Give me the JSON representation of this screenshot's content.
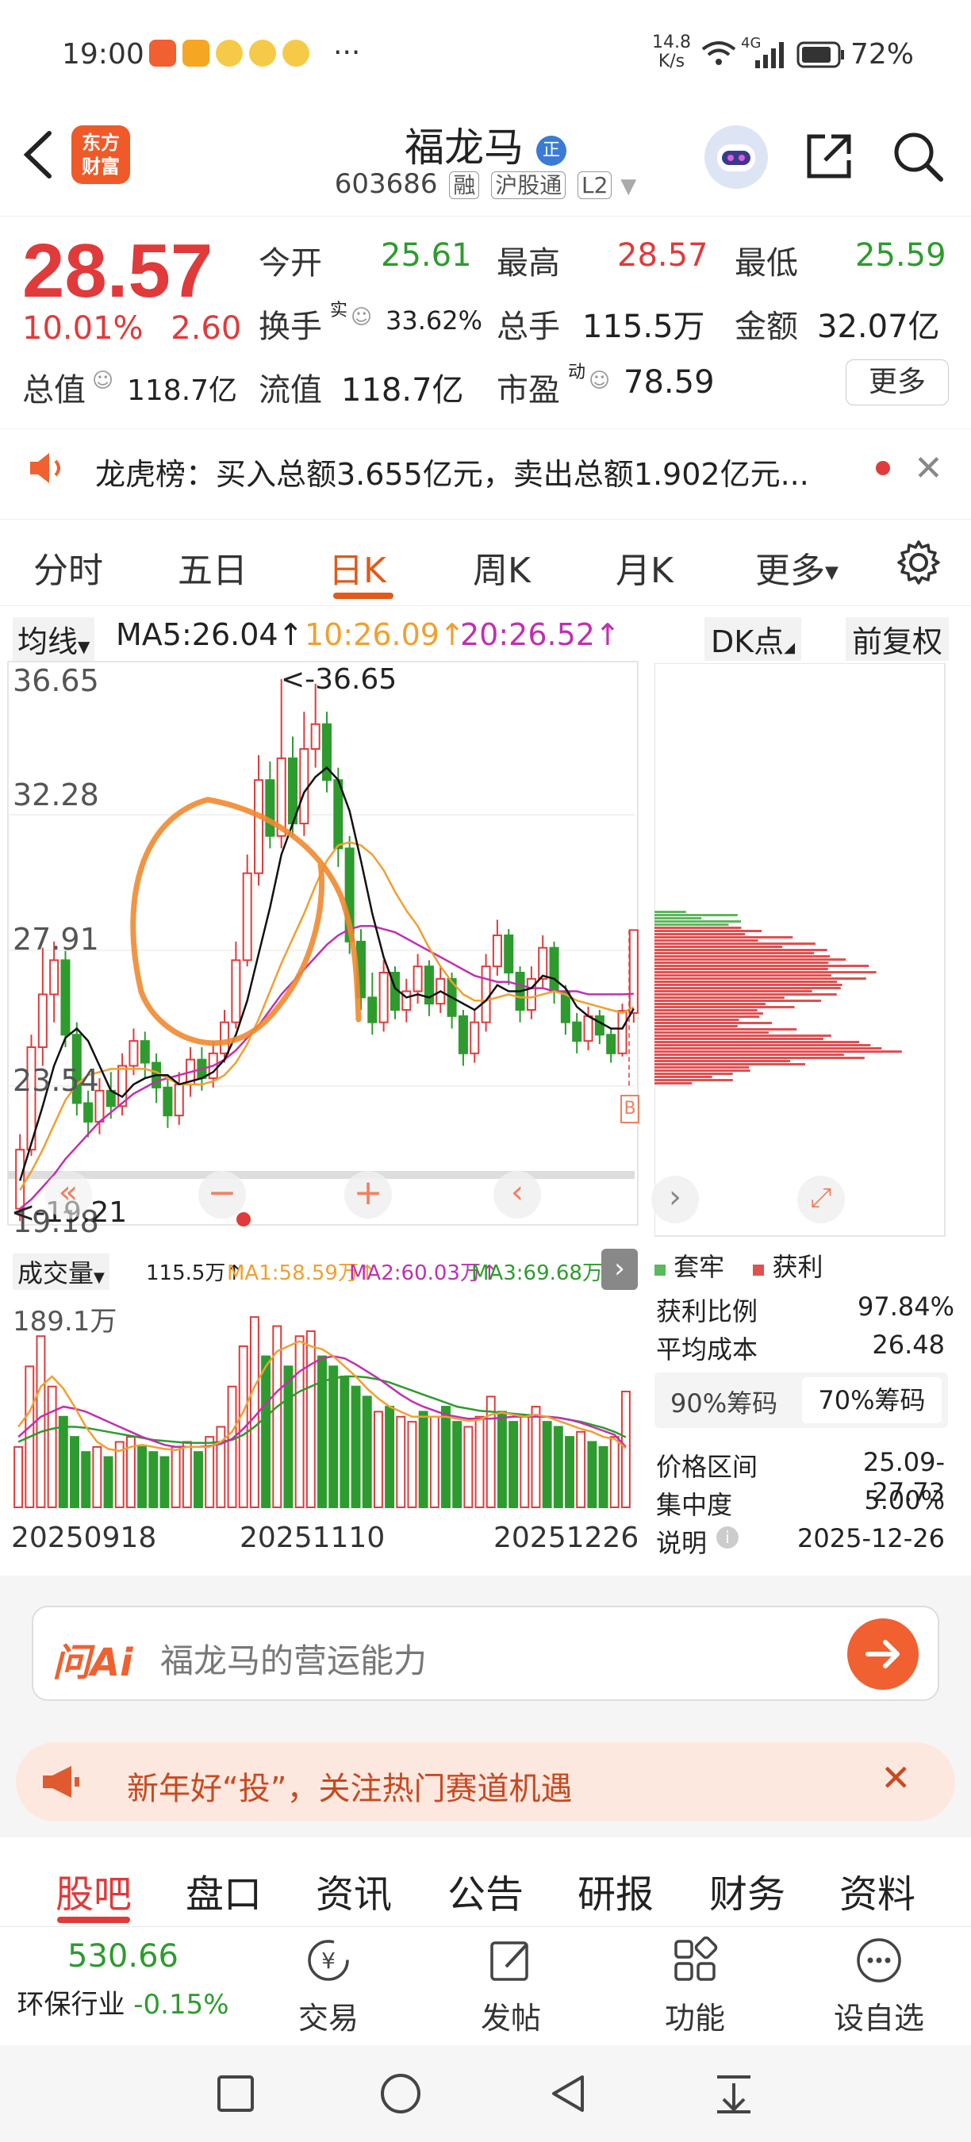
{
  "status_bar": {
    "time": "19:00",
    "extra": "···",
    "net_speed_top": "14.8",
    "net_speed_bottom": "K/s",
    "signal": "4G",
    "battery": "72%"
  },
  "header": {
    "back": "<",
    "logo_line1": "东方",
    "logo_line2": "财富",
    "stock_name": "福龙马",
    "name_badge": "正",
    "stock_code": "603686",
    "tags": [
      "融",
      "沪股通",
      "L2"
    ]
  },
  "quote": {
    "price": "28.57",
    "change_pct": "10.01%",
    "change_amt": "2.60",
    "open_label": "今开",
    "open": "25.61",
    "high_label": "最高",
    "high": "28.57",
    "low_label": "最低",
    "low": "25.59",
    "turnover_label": "换手",
    "turnover_sup": "实",
    "turnover": "33.62%",
    "volume_label": "总手",
    "volume": "115.5万",
    "amount_label": "金额",
    "amount": "32.07亿",
    "mktcap_label": "总值",
    "mktcap": "118.7亿",
    "float_label": "流值",
    "float_cap": "118.7亿",
    "pe_label": "市盈",
    "pe_sup": "动",
    "pe": "78.59",
    "more": "更多"
  },
  "notice": {
    "text": "龙虎榜：买入总额3.655亿元，卖出总额1.902亿元..."
  },
  "ktabs": [
    "分时",
    "五日",
    "日K",
    "周K",
    "月K",
    "更多"
  ],
  "ktab_active": 2,
  "chart_head": {
    "ma_select": "均线",
    "ma5": "MA5:26.04↑",
    "ma10": "10:26.09↑",
    "ma20": "20:26.52↑",
    "dk": "DK点",
    "adjust": "前复权"
  },
  "colors": {
    "up": "#e03a3a",
    "down": "#2e9b2e",
    "ma5": "#111111",
    "ma10": "#f0a030",
    "ma20": "#c030b0",
    "accent": "#e05a1a"
  },
  "chart_data": {
    "type": "candlestick",
    "y_ticks": [
      "36.65",
      "32.28",
      "27.91",
      "23.54",
      "19.18"
    ],
    "ylim": [
      19.18,
      36.65
    ],
    "annotations": [
      "<-36.65",
      "<-19.21"
    ],
    "x_labels": [
      "20250918",
      "20251110",
      "20251226"
    ],
    "candles": [
      {
        "o": 19.6,
        "c": 21.5,
        "h": 22.0,
        "l": 19.2
      },
      {
        "o": 21.5,
        "c": 24.8,
        "h": 25.2,
        "l": 21.3
      },
      {
        "o": 24.8,
        "c": 26.5,
        "h": 28.0,
        "l": 24.2
      },
      {
        "o": 26.5,
        "c": 27.6,
        "h": 28.2,
        "l": 25.6
      },
      {
        "o": 27.6,
        "c": 25.2,
        "h": 27.9,
        "l": 24.8
      },
      {
        "o": 25.2,
        "c": 23.0,
        "h": 25.6,
        "l": 22.6
      },
      {
        "o": 23.0,
        "c": 22.4,
        "h": 23.4,
        "l": 21.9
      },
      {
        "o": 22.4,
        "c": 23.4,
        "h": 23.8,
        "l": 22.0
      },
      {
        "o": 23.4,
        "c": 22.9,
        "h": 24.0,
        "l": 22.5
      },
      {
        "o": 22.9,
        "c": 24.2,
        "h": 24.6,
        "l": 22.6
      },
      {
        "o": 24.2,
        "c": 25.0,
        "h": 25.4,
        "l": 23.9
      },
      {
        "o": 25.0,
        "c": 24.3,
        "h": 25.3,
        "l": 23.8
      },
      {
        "o": 24.3,
        "c": 23.5,
        "h": 24.6,
        "l": 23.0
      },
      {
        "o": 23.5,
        "c": 22.6,
        "h": 23.9,
        "l": 22.2
      },
      {
        "o": 22.6,
        "c": 23.6,
        "h": 24.0,
        "l": 22.3
      },
      {
        "o": 23.6,
        "c": 24.4,
        "h": 24.8,
        "l": 23.2
      },
      {
        "o": 24.4,
        "c": 23.8,
        "h": 24.8,
        "l": 23.4
      },
      {
        "o": 23.8,
        "c": 24.6,
        "h": 25.0,
        "l": 23.5
      },
      {
        "o": 24.6,
        "c": 25.6,
        "h": 26.0,
        "l": 24.3
      },
      {
        "o": 25.6,
        "c": 27.6,
        "h": 28.2,
        "l": 25.4
      },
      {
        "o": 27.6,
        "c": 30.4,
        "h": 31.0,
        "l": 27.4
      },
      {
        "o": 30.4,
        "c": 33.4,
        "h": 34.2,
        "l": 30.0
      },
      {
        "o": 33.4,
        "c": 31.6,
        "h": 34.0,
        "l": 31.2
      },
      {
        "o": 31.6,
        "c": 34.1,
        "h": 36.65,
        "l": 31.2
      },
      {
        "o": 34.1,
        "c": 32.0,
        "h": 34.8,
        "l": 31.6
      },
      {
        "o": 32.0,
        "c": 34.4,
        "h": 35.6,
        "l": 31.6
      },
      {
        "o": 34.4,
        "c": 35.2,
        "h": 36.5,
        "l": 33.8
      },
      {
        "o": 35.2,
        "c": 33.4,
        "h": 35.6,
        "l": 33.0
      },
      {
        "o": 33.4,
        "c": 31.2,
        "h": 33.8,
        "l": 30.6
      },
      {
        "o": 31.2,
        "c": 28.2,
        "h": 31.6,
        "l": 27.8
      },
      {
        "o": 28.2,
        "c": 26.4,
        "h": 28.6,
        "l": 26.0
      },
      {
        "o": 26.4,
        "c": 25.6,
        "h": 27.2,
        "l": 25.2
      },
      {
        "o": 25.6,
        "c": 27.2,
        "h": 27.6,
        "l": 25.3
      },
      {
        "o": 27.2,
        "c": 26.0,
        "h": 27.4,
        "l": 25.7
      },
      {
        "o": 26.0,
        "c": 26.6,
        "h": 27.0,
        "l": 25.6
      },
      {
        "o": 26.6,
        "c": 27.4,
        "h": 27.8,
        "l": 26.2
      },
      {
        "o": 27.4,
        "c": 26.2,
        "h": 27.6,
        "l": 25.8
      },
      {
        "o": 26.2,
        "c": 27.0,
        "h": 27.4,
        "l": 25.9
      },
      {
        "o": 27.0,
        "c": 25.8,
        "h": 27.2,
        "l": 25.4
      },
      {
        "o": 25.8,
        "c": 24.6,
        "h": 26.0,
        "l": 24.2
      },
      {
        "o": 24.6,
        "c": 25.6,
        "h": 26.0,
        "l": 24.3
      },
      {
        "o": 25.6,
        "c": 27.4,
        "h": 27.8,
        "l": 25.3
      },
      {
        "o": 27.4,
        "c": 28.4,
        "h": 28.9,
        "l": 27.1
      },
      {
        "o": 28.4,
        "c": 27.2,
        "h": 28.6,
        "l": 26.8
      },
      {
        "o": 27.2,
        "c": 26.0,
        "h": 27.4,
        "l": 25.6
      },
      {
        "o": 26.0,
        "c": 27.0,
        "h": 27.4,
        "l": 25.7
      },
      {
        "o": 27.0,
        "c": 28.0,
        "h": 28.4,
        "l": 26.7
      },
      {
        "o": 28.0,
        "c": 26.6,
        "h": 28.2,
        "l": 26.2
      },
      {
        "o": 26.6,
        "c": 25.6,
        "h": 26.8,
        "l": 25.2
      },
      {
        "o": 25.6,
        "c": 25.0,
        "h": 25.9,
        "l": 24.6
      },
      {
        "o": 25.0,
        "c": 25.8,
        "h": 26.1,
        "l": 24.7
      },
      {
        "o": 25.8,
        "c": 25.2,
        "h": 26.0,
        "l": 24.9
      },
      {
        "o": 25.2,
        "c": 24.6,
        "h": 25.4,
        "l": 24.3
      },
      {
        "o": 24.6,
        "c": 25.97,
        "h": 26.2,
        "l": 24.5
      },
      {
        "o": 25.9,
        "c": 28.57,
        "h": 28.57,
        "l": 25.59
      }
    ],
    "ma5": [
      20.5,
      21.7,
      22.9,
      24.2,
      25.1,
      25.4,
      25.0,
      24.2,
      23.4,
      23.2,
      23.6,
      23.8,
      23.9,
      23.9,
      23.6,
      23.7,
      23.8,
      24.0,
      24.4,
      25.2,
      26.3,
      27.8,
      29.3,
      31.0,
      32.0,
      33.0,
      33.5,
      33.8,
      33.4,
      32.4,
      30.8,
      29.1,
      27.7,
      26.7,
      26.4,
      26.5,
      26.4,
      26.6,
      26.4,
      26.2,
      26.0,
      26.3,
      26.8,
      26.6,
      26.6,
      26.7,
      27.1,
      27.0,
      26.7,
      26.1,
      25.8,
      25.6,
      25.4,
      25.4,
      26.04
    ],
    "ma10": [
      20.2,
      20.8,
      21.5,
      22.3,
      23.1,
      23.6,
      23.9,
      24.0,
      24.1,
      24.1,
      24.1,
      24.1,
      24.0,
      23.8,
      23.6,
      23.6,
      23.6,
      23.7,
      23.9,
      24.3,
      24.9,
      25.7,
      26.6,
      27.5,
      28.3,
      29.1,
      30.0,
      30.8,
      31.3,
      31.4,
      31.3,
      31.0,
      30.5,
      29.8,
      29.2,
      28.7,
      28.0,
      27.4,
      26.9,
      26.5,
      26.3,
      26.3,
      26.4,
      26.5,
      26.4,
      26.4,
      26.5,
      26.6,
      26.5,
      26.3,
      26.2,
      26.1,
      26.0,
      25.9,
      26.09
    ],
    "ma20": [
      19.6,
      19.9,
      20.3,
      20.7,
      21.2,
      21.6,
      22.0,
      22.4,
      22.7,
      23.0,
      23.3,
      23.5,
      23.7,
      23.8,
      23.9,
      24.0,
      24.1,
      24.2,
      24.4,
      24.7,
      25.1,
      25.5,
      26.0,
      26.5,
      26.9,
      27.3,
      27.7,
      28.1,
      28.4,
      28.6,
      28.7,
      28.7,
      28.6,
      28.5,
      28.3,
      28.1,
      27.9,
      27.7,
      27.5,
      27.3,
      27.1,
      27.0,
      26.9,
      26.9,
      26.8,
      26.7,
      26.7,
      26.6,
      26.6,
      26.6,
      26.5,
      26.5,
      26.5,
      26.5,
      26.52
    ],
    "volume_max_label": "189.1万",
    "volumes": [
      60,
      140,
      170,
      120,
      90,
      70,
      55,
      60,
      50,
      65,
      70,
      60,
      55,
      50,
      60,
      65,
      55,
      70,
      80,
      120,
      160,
      189,
      150,
      180,
      140,
      170,
      175,
      150,
      140,
      130,
      120,
      110,
      95,
      100,
      90,
      85,
      95,
      90,
      100,
      85,
      80,
      90,
      110,
      95,
      85,
      90,
      100,
      85,
      80,
      70,
      75,
      65,
      60,
      70,
      115
    ],
    "volume_up": [
      1,
      1,
      1,
      1,
      0,
      0,
      0,
      1,
      0,
      1,
      1,
      0,
      0,
      0,
      1,
      1,
      0,
      1,
      1,
      1,
      1,
      1,
      0,
      1,
      0,
      1,
      1,
      0,
      0,
      0,
      0,
      0,
      1,
      0,
      1,
      1,
      0,
      1,
      0,
      0,
      1,
      1,
      1,
      0,
      0,
      1,
      1,
      0,
      0,
      0,
      1,
      0,
      0,
      1,
      1
    ],
    "vol_ma1": [
      80,
      95,
      120,
      130,
      118,
      100,
      80,
      65,
      58,
      56,
      60,
      62,
      60,
      58,
      57,
      60,
      60,
      60,
      65,
      75,
      95,
      120,
      140,
      155,
      160,
      165,
      160,
      157,
      150,
      140,
      130,
      118,
      108,
      100,
      95,
      90,
      90,
      90,
      90,
      88,
      86,
      87,
      92,
      94,
      92,
      90,
      92,
      90,
      86,
      82,
      78,
      75,
      70,
      68,
      58.59
    ],
    "vol_ma2": [
      70,
      80,
      90,
      95,
      100,
      98,
      95,
      90,
      85,
      80,
      75,
      70,
      66,
      62,
      60,
      60,
      60,
      61,
      63,
      68,
      78,
      90,
      103,
      115,
      125,
      135,
      142,
      148,
      150,
      148,
      142,
      135,
      128,
      120,
      112,
      105,
      100,
      96,
      92,
      90,
      88,
      88,
      88,
      89,
      90,
      90,
      90,
      90,
      89,
      87,
      84,
      80,
      76,
      72,
      60.03
    ],
    "vol_ma3": [
      65,
      70,
      75,
      78,
      80,
      80,
      79,
      77,
      75,
      73,
      71,
      69,
      67,
      66,
      65,
      64,
      64,
      64,
      65,
      67,
      72,
      80,
      90,
      100,
      108,
      115,
      120,
      125,
      128,
      130,
      130,
      129,
      127,
      124,
      120,
      116,
      112,
      108,
      104,
      100,
      98,
      96,
      95,
      94,
      93,
      92,
      91,
      90,
      89,
      87,
      85,
      82,
      79,
      75,
      69.68
    ]
  },
  "vol_head": {
    "select": "成交量",
    "val": "115.5万↑",
    "ma1": "MA1:58.59万↑",
    "ma2": "MA2:60.03万↑",
    "ma3": "MA3:69.68万↑"
  },
  "chips": {
    "legend_trapped": "套牢",
    "legend_profit": "获利",
    "profit_ratio_label": "获利比例",
    "profit_ratio": "97.84%",
    "avg_cost_label": "平均成本",
    "avg_cost": "26.48",
    "tab_90": "90%筹码",
    "tab_70": "70%筹码",
    "range_label": "价格区间",
    "range": "25.09-27.73",
    "concentration_label": "集中度",
    "concentration": "5.00%",
    "note_label": "说明",
    "note": "2025-12-26"
  },
  "ai": {
    "brand": "问Ai",
    "placeholder": "福龙马的营运能力"
  },
  "promo": {
    "text": "新年好“投”，关注热门赛道机遇"
  },
  "bottom_tabs": [
    "股吧",
    "盘口",
    "资讯",
    "公告",
    "研报",
    "财务",
    "资料"
  ],
  "toolbar": {
    "index_value": "530.66",
    "index_name": "环保行业",
    "index_change": "-0.15%",
    "items": [
      "交易",
      "发帖",
      "功能",
      "设自选"
    ]
  }
}
